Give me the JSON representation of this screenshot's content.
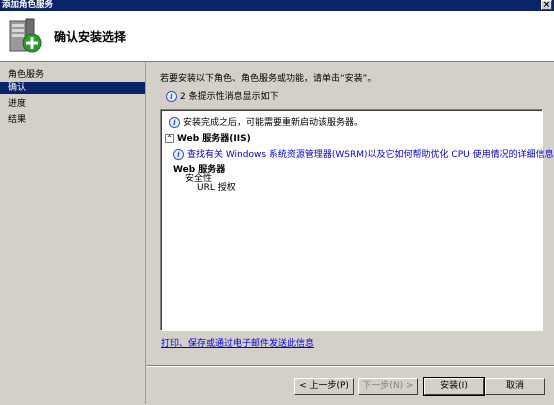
{
  "window": {
    "title": "添加角色服务",
    "close_glyph": "×"
  },
  "header": {
    "title": "确认安装选择"
  },
  "sidebar": {
    "group_label": "角色服务",
    "items": [
      {
        "label": "确认",
        "selected": true
      },
      {
        "label": "进度",
        "selected": false
      },
      {
        "label": "结果",
        "selected": false
      }
    ]
  },
  "content": {
    "intro": "若要安装以下角色、角色服务或功能，请单击“安装”。",
    "info_message": "2 条提示性消息显示如下",
    "list": {
      "restart_notice": "安装完成之后，可能需要重新启动该服务器。",
      "section_title": "Web 服务器(IIS)",
      "section_link": "查找有关 Windows 系统资源管理器(WSRM)以及它如何帮助优化 CPU 使用情况的详细信息",
      "sub_heading": "Web 服务器",
      "sub_item_1": "安全性",
      "sub_item_2": "URL 授权"
    },
    "print_link": "打印、保存或通过电子邮件发送此信息"
  },
  "footer": {
    "prev": "< 上一步(P)",
    "next": "下一步(N) >",
    "install": "安装(I)",
    "cancel": "取消"
  },
  "icons": {
    "info": "i",
    "collapse": "^"
  },
  "colors": {
    "selection": "#0a246a",
    "link": "#0000ee",
    "face": "#d4d0c8"
  }
}
